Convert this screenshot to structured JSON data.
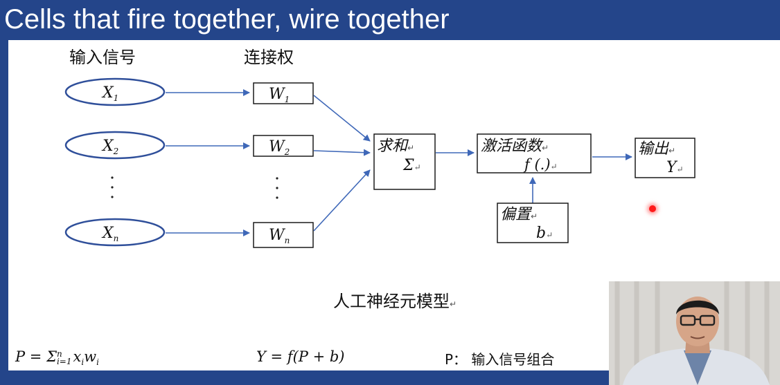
{
  "title": "Cells that fire together, wire together",
  "diagram": {
    "header_inputs": "输入信号",
    "header_weights": "连接权",
    "inputs": [
      "X1",
      "X2",
      "Xn"
    ],
    "input_labels": [
      {
        "main": "X",
        "sub": "1"
      },
      {
        "main": "X",
        "sub": "2"
      },
      {
        "main": "X",
        "sub": "n"
      }
    ],
    "weights": [
      {
        "main": "W",
        "sub": "1"
      },
      {
        "main": "W",
        "sub": "2"
      },
      {
        "main": "W",
        "sub": "n"
      }
    ],
    "ellipsis": ".\n.\n.",
    "sum_label": "求和",
    "sum_symbol": "Σ",
    "activation_label": "激活函数",
    "activation_symbol": "f (.)",
    "bias_label": "偏置",
    "bias_symbol": "b",
    "output_label": "输出",
    "output_symbol": "Y",
    "return_mark": "↵",
    "caption": "人工神经元模型"
  },
  "formulas": {
    "p_formula": {
      "lhs": "P = Σ",
      "sup": "n",
      "sub": "i=1",
      "rest": "x",
      "rest_sub": "i",
      "rest2": "w",
      "rest2_sub": "i"
    },
    "y_formula": "Y = f(P + b)",
    "p_description": "P：  输入信号组合"
  },
  "colors": {
    "title_bar": "#24458a",
    "box_border": "#1a1a1a",
    "ellipse_border": "#2f4f9a",
    "arrow": "#3f68b8"
  },
  "webcam": "presenter-video"
}
